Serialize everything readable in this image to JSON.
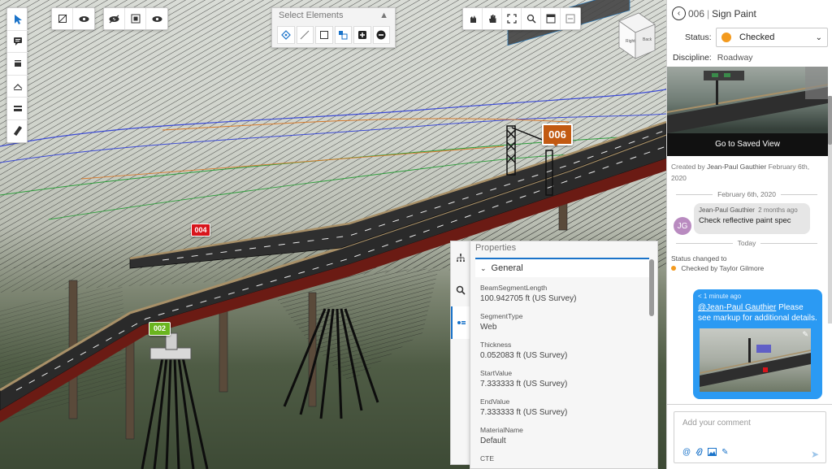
{
  "markers": {
    "m006": "006",
    "m004": "004",
    "m002": "002"
  },
  "select_elements": {
    "title": "Select Elements"
  },
  "view_cube": {
    "face_right": "Right",
    "face_back": "Back"
  },
  "properties": {
    "title": "Properties",
    "section": "General",
    "items": [
      {
        "label": "BeamSegmentLength",
        "value": "100.942705 ft (US Survey)"
      },
      {
        "label": "SegmentType",
        "value": "Web"
      },
      {
        "label": "Thickness",
        "value": "0.052083 ft (US Survey)"
      },
      {
        "label": "StartValue",
        "value": "7.333333 ft (US Survey)"
      },
      {
        "label": "EndValue",
        "value": "7.333333 ft (US Survey)"
      },
      {
        "label": "MaterialName",
        "value": "Default"
      },
      {
        "label": "CTE",
        "value": ""
      }
    ]
  },
  "issue": {
    "number": "006",
    "title": "Sign Paint",
    "status_label": "Status:",
    "status_value": "Checked",
    "status_color": "#f39a1e",
    "discipline_label": "Discipline:",
    "discipline_value": "Roadway",
    "saved_view_button": "Go to Saved View",
    "created_prefix": "Created by",
    "created_by": "Jean-Paul Gauthier",
    "created_date_a": "February 6th,",
    "created_date_b": "2020",
    "divider_date": "February 6th, 2020",
    "comment1": {
      "avatar": "JG",
      "author": "Jean-Paul Gauthier",
      "when": "2 months ago",
      "text": "Check reflective paint spec"
    },
    "divider_today": "Today",
    "status_change_line": "Status changed to",
    "status_change_value": "Checked",
    "status_change_by": "by Taylor Gilmore",
    "comment2": {
      "when": "< 1 minute ago",
      "mention": "@Jean-Paul Gauthier",
      "text": " Please see markup for additional details."
    },
    "comment_placeholder": "Add your comment"
  },
  "colors": {
    "accent": "#1a73c9",
    "marker_006": "#c25a12",
    "marker_004": "#d8141b",
    "marker_002": "#6ab51f",
    "bubble": "#2b9af3"
  }
}
